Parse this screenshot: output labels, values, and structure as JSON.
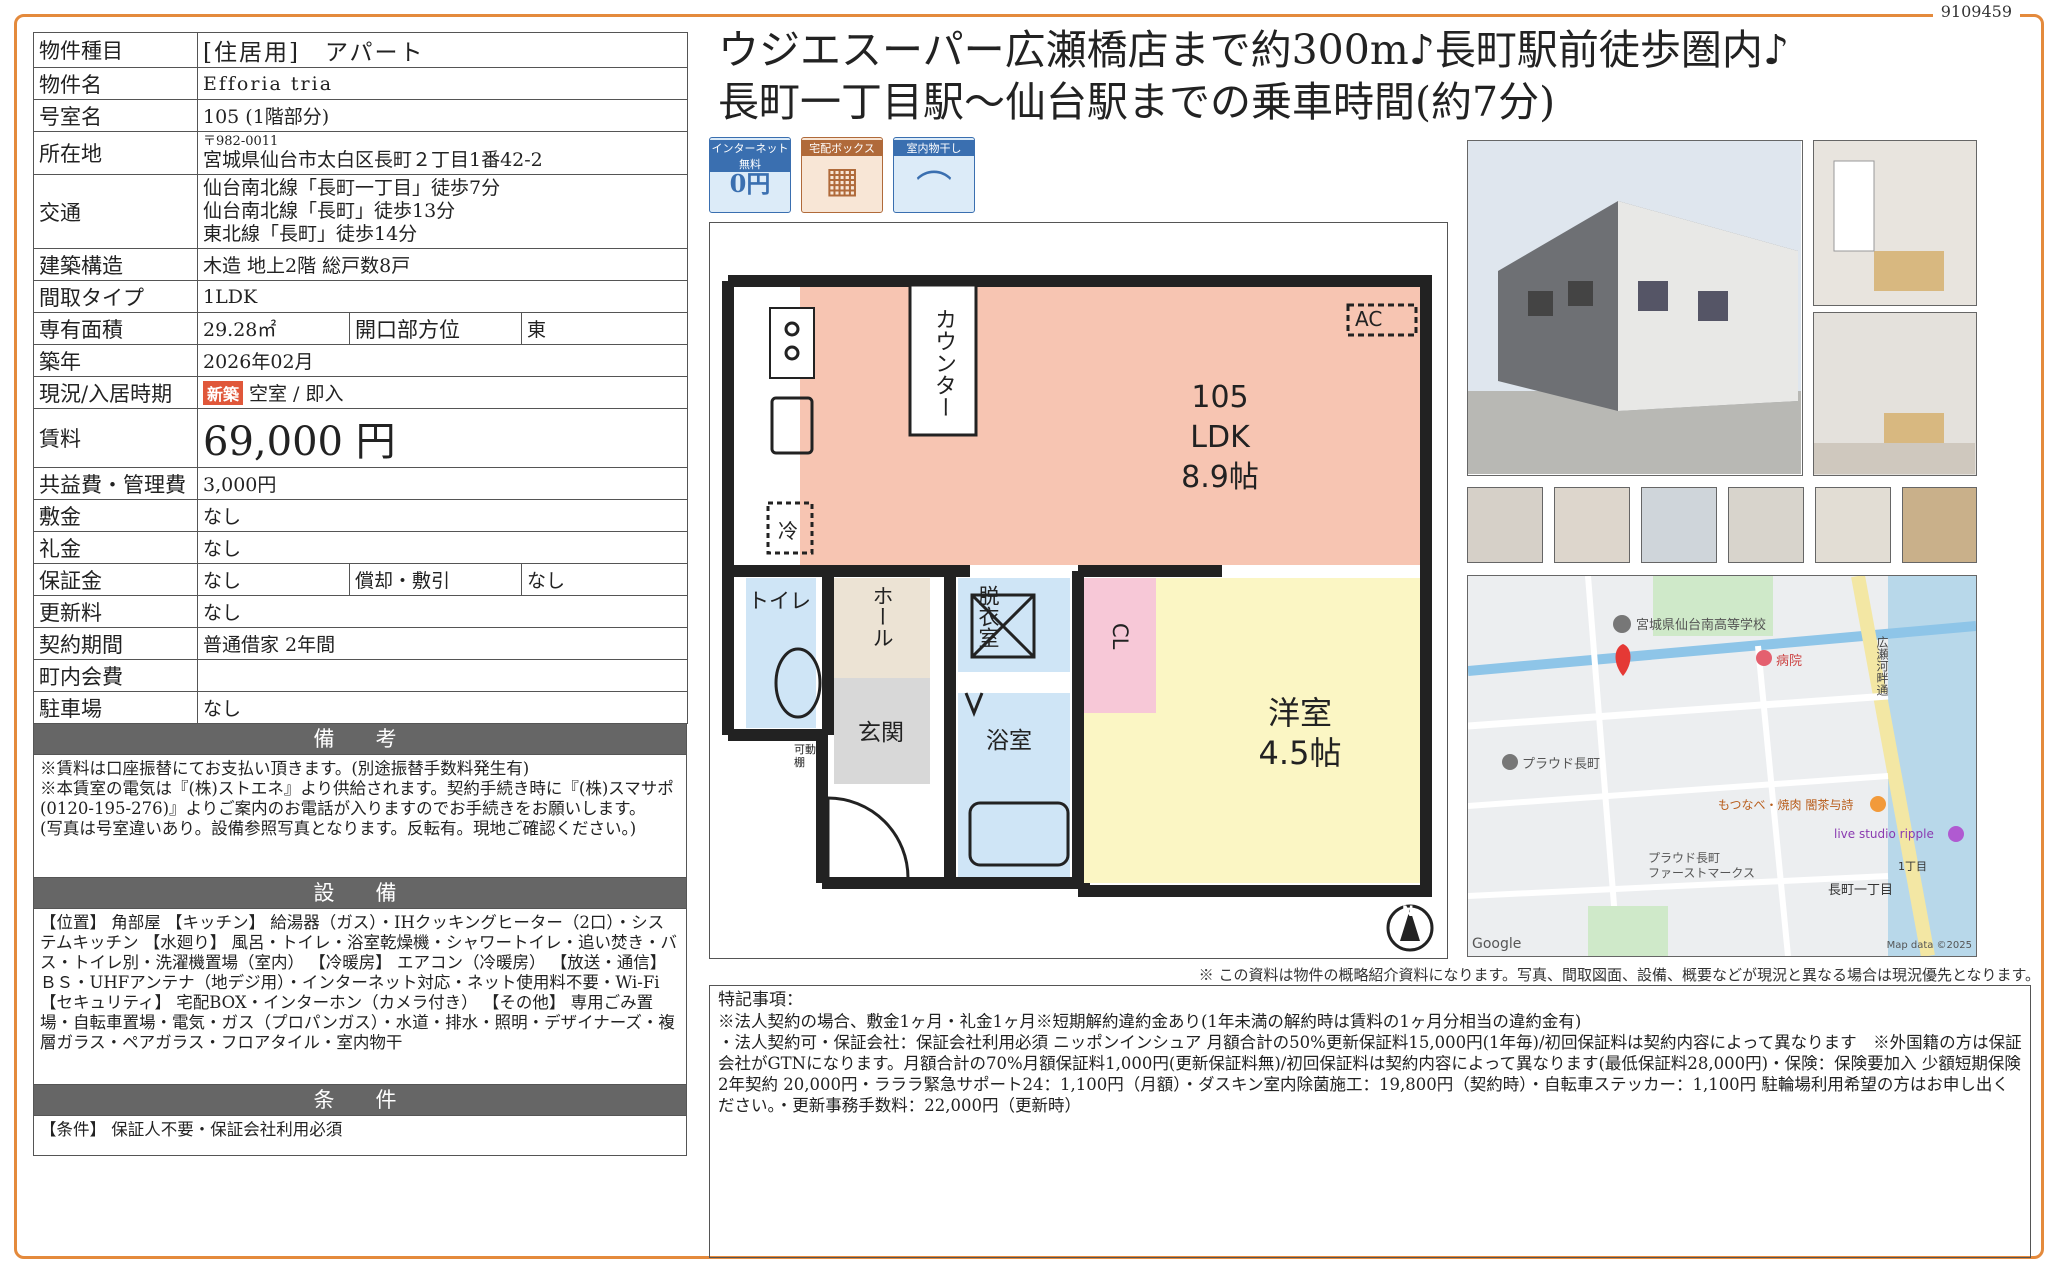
{
  "doc_id": "9109459",
  "headline": [
    "ウジエスーパー広瀬橋店まで約300m♪長町駅前徒歩圏内♪",
    "長町一丁目駅〜仙台駅までの乗車時間(約7分)"
  ],
  "spec": {
    "type_label": "物件種目",
    "type_value": "[住居用]　アパート",
    "name_label": "物件名",
    "name_value": "Efforia tria",
    "room_label": "号室名",
    "room_value": "105 (1階部分)",
    "address_label": "所在地",
    "zip": "〒982-0011",
    "address_value": "宮城県仙台市太白区長町２丁目1番42-2",
    "access_label": "交通",
    "access": [
      "仙台南北線「長町一丁目」徒歩7分",
      "仙台南北線「長町」徒歩13分",
      "東北線「長町」徒歩14分"
    ],
    "structure_label": "建築構造",
    "structure_value": "木造 地上2階 総戸数8戸",
    "layout_label": "間取タイプ",
    "layout_value": "1LDK",
    "area_label": "専有面積",
    "area_value": "29.28㎡",
    "direction_label": "開口部方位",
    "direction_value": "東",
    "built_label": "築年",
    "built_value": "2026年02月",
    "status_label": "現況/入居時期",
    "status_badge": "新築",
    "status_value": "空室 / 即入",
    "rent_label": "賃料",
    "rent_value": "69,000 円",
    "fee_label": "共益費・管理費",
    "fee_value": "3,000円",
    "deposit_label": "敷金",
    "deposit_value": "なし",
    "key_label": "礼金",
    "key_value": "なし",
    "guarantee_label": "保証金",
    "guarantee_value": "なし",
    "amort_label": "償却・敷引",
    "amort_value": "なし",
    "renewal_label": "更新料",
    "renewal_value": "なし",
    "contract_label": "契約期間",
    "contract_value": "普通借家 2年間",
    "town_label": "町内会費",
    "town_value": "",
    "parking_label": "駐車場",
    "parking_value": "なし"
  },
  "remarks": {
    "title": "備　考",
    "text": "※賃料は口座振替にてお支払い頂きます。(別途振替手数料発生有)\n※本賃室の電気は『(株)ストエネ』より供給されます。契約手続き時に『(株)スマサポ(0120-195-276)』よりご案内のお電話が入りますのでお手続きをお願いします。\n(写真は号室違いあり。設備参照写真となります。反転有。現地ご確認ください。)"
  },
  "equipment": {
    "title": "設　備",
    "text": "【位置】 角部屋 【キッチン】 給湯器（ガス）・IHクッキングヒーター（2口）・システムキッチン 【水廻り】 風呂・トイレ・浴室乾燥機・シャワートイレ・追い焚き・バス・トイレ別・洗濯機置場（室内） 【冷暖房】 エアコン（冷暖房） 【放送・通信】 ＢＳ・UHFアンテナ（地デジ用）・インターネット対応・ネット使用料不要・Wi-Fi 【セキュリティ】 宅配BOX・インターホン（カメラ付き） 【その他】 専用ごみ置場・自転車置場・電気・ガス（プロパンガス）・水道・排水・照明・デザイナーズ・複層ガラス・ペアガラス・フロアタイル・室内物干"
  },
  "conditions": {
    "title": "条　件",
    "text": "【条件】 保証人不要・保証会社利用必須"
  },
  "icons": [
    {
      "caption": "インターネット無料",
      "name": "internet-free-icon",
      "glyph": "0円"
    },
    {
      "caption": "宅配ボックス",
      "name": "delivery-box-icon",
      "glyph": "▦"
    },
    {
      "caption": "室内物干し",
      "name": "indoor-drying-icon",
      "glyph": "⌒"
    }
  ],
  "floorplan": {
    "ldk_no": "105",
    "ldk": "LDK",
    "ldk_size": "8.9帖",
    "counter": "カウンター",
    "ac": "AC",
    "fridge": "冷",
    "toilet": "トイレ",
    "hall": "ホール",
    "washroom": "脱衣室",
    "cl": "CL",
    "western": "洋室",
    "western_size": "4.5帖",
    "entrance": "玄関",
    "bath": "浴室",
    "shelf": "可動棚",
    "north": "N"
  },
  "map": {
    "school": "宮城県仙台南高等学校",
    "hospital": "病院",
    "bld1": "プラウド長町",
    "bld2": "プラウド長町\nファーストマークス",
    "rest": "もつなべ・焼肉 闇茶与詩",
    "live": "live studio ripple",
    "station": "長町一丁目",
    "chome": "1丁目",
    "road": "広瀬河畔通",
    "google": "Google",
    "copyright": "Map data ©2025"
  },
  "disclaimer": "※ この資料は物件の概略紹介資料になります。写真、間取図面、設備、概要などが現況と異なる場合は現況優先となります。",
  "special": {
    "title": "特記事項：",
    "lines": [
      "※法人契約の場合、敷金1ヶ月・礼金1ヶ月※短期解約違約金あり(1年未満の解約時は賃料の1ヶ月分相当の違約金有)",
      "・法人契約可・保証会社：保証会社利用必須 ニッポンインシュア 月額合計の50%更新保証料15,000円(1年毎)/初回保証料は契約内容によって異なります　※外国籍の方は保証会社がGTNになります。月額合計の70%月額保証料1,000円(更新保証料無)/初回保証料は契約内容によって異なります(最低保証料28,000円)・保険：保険要加入 少額短期保険 2年契約 20,000円・ラララ緊急サポート24：1,100円（月額）・ダスキン室内除菌施工：19,800円（契約時）・自転車ステッカー：1,100円 駐輪場利用希望の方はお申し出ください。・更新事務手数料：22,000円（更新時）"
    ]
  },
  "colors": {
    "frame": "#e48a3c",
    "ldk": "#f7c5b2",
    "western": "#fbf6c4",
    "wet": "#cfe5f6",
    "cl": "#f7c8d7",
    "hall": "#ece3d4",
    "entrance": "#d8d8d8",
    "badge": "#e0573a"
  }
}
